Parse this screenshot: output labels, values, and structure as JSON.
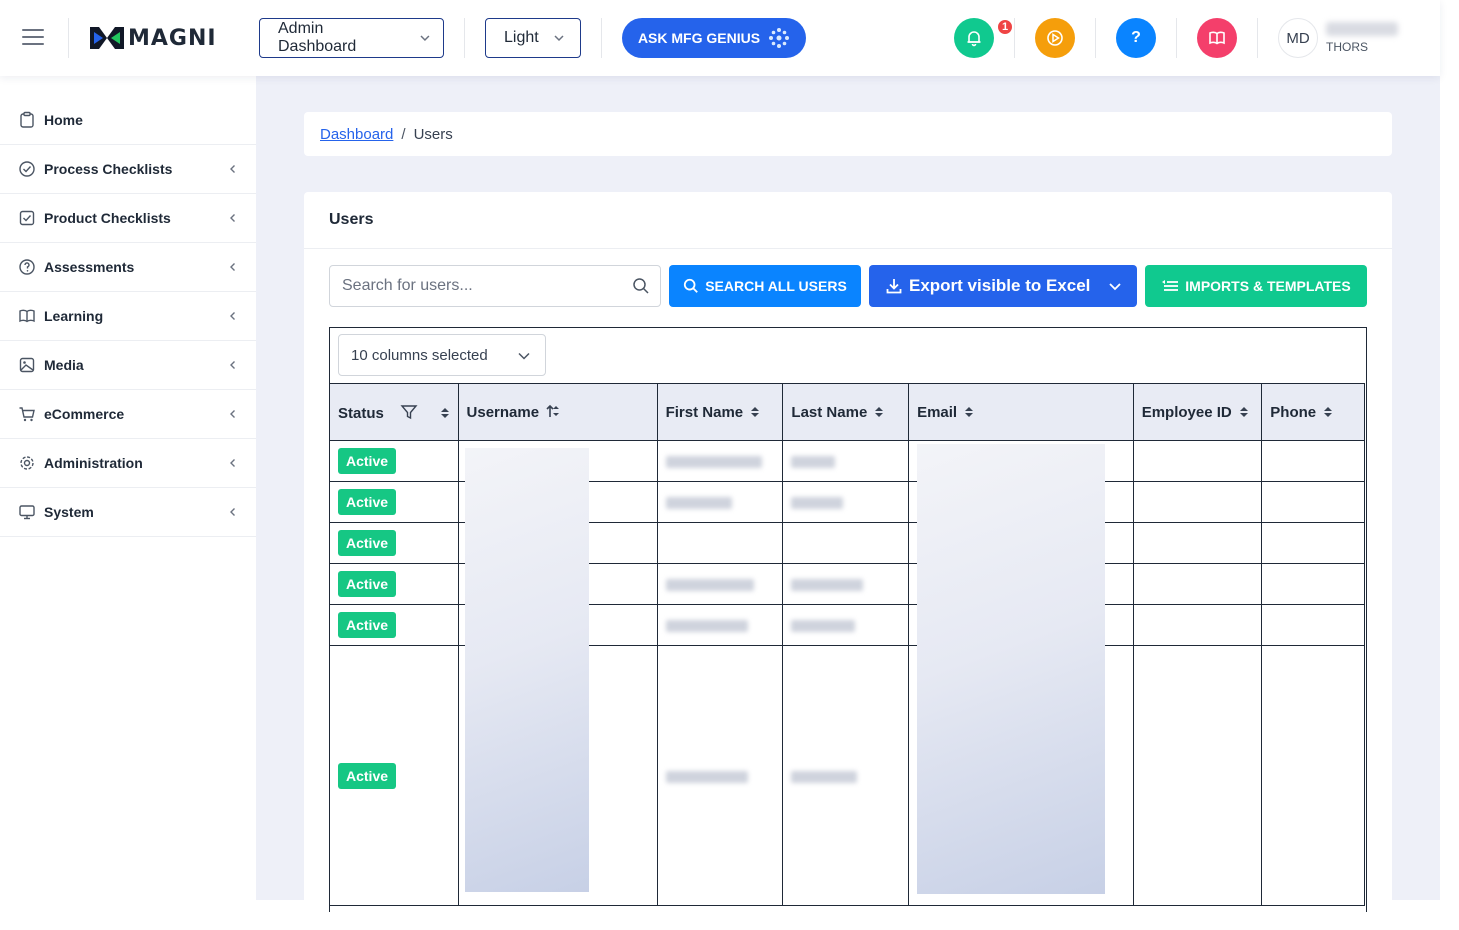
{
  "header": {
    "logo_text": "MAGNI",
    "dashboard_select": "Admin Dashboard",
    "theme_select": "Light",
    "ask_button": "ASK MFG GENIUS",
    "notification_count": "1",
    "help_label": "?",
    "user_initials": "MD",
    "user_org": "THORS",
    "colors": {
      "notification": "#10c98f",
      "play": "#f59e0b",
      "help": "#0a84ff",
      "book": "#f43f6b",
      "ask": "#2563eb"
    }
  },
  "sidebar": {
    "items": [
      {
        "label": "Home",
        "icon": "clipboard-icon",
        "has_submenu": false
      },
      {
        "label": "Process Checklists",
        "icon": "check-circle-icon",
        "has_submenu": true
      },
      {
        "label": "Product Checklists",
        "icon": "check-square-icon",
        "has_submenu": true
      },
      {
        "label": "Assessments",
        "icon": "question-circle-icon",
        "has_submenu": true
      },
      {
        "label": "Learning",
        "icon": "book-icon",
        "has_submenu": true
      },
      {
        "label": "Media",
        "icon": "image-icon",
        "has_submenu": true
      },
      {
        "label": "eCommerce",
        "icon": "cart-icon",
        "has_submenu": true
      },
      {
        "label": "Administration",
        "icon": "gear-icon",
        "has_submenu": true
      },
      {
        "label": "System",
        "icon": "monitor-icon",
        "has_submenu": true
      }
    ]
  },
  "breadcrumb": {
    "parent": "Dashboard",
    "separator": "/",
    "current": "Users"
  },
  "users_card": {
    "title": "Users",
    "search_placeholder": "Search for users...",
    "search_all_button": "SEARCH ALL USERS",
    "export_button": "Export visible to Excel",
    "imports_button": "IMPORTS & TEMPLATES",
    "columns_selected": "10 columns selected"
  },
  "table": {
    "columns": [
      "Status",
      "Username",
      "First Name",
      "Last Name",
      "Email",
      "Employee ID",
      "Phone"
    ],
    "rows": [
      {
        "status": "Active"
      },
      {
        "status": "Active"
      },
      {
        "status": "Active"
      },
      {
        "status": "Active"
      },
      {
        "status": "Active"
      },
      {
        "status": "Active"
      }
    ]
  }
}
